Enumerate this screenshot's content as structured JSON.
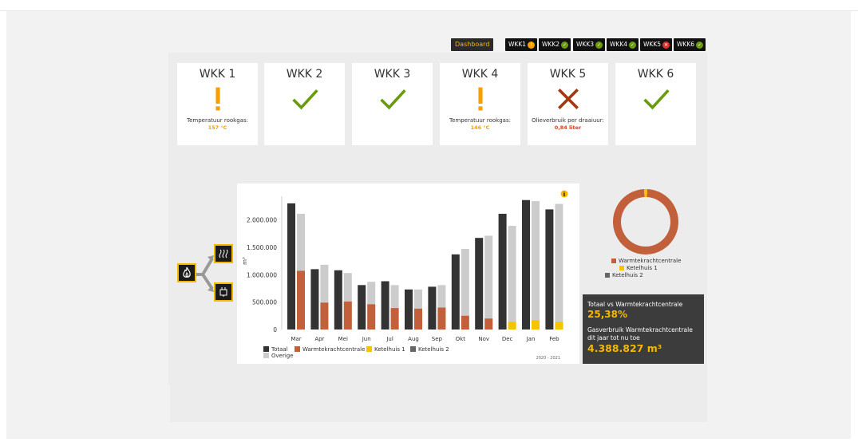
{
  "nav": {
    "dashboard_label": "Dashboard",
    "tabs": [
      {
        "label": "WKK1",
        "status": "warning"
      },
      {
        "label": "WKK2",
        "status": "ok"
      },
      {
        "label": "WKK3",
        "status": "ok"
      },
      {
        "label": "WKK4",
        "status": "ok"
      },
      {
        "label": "WKK5",
        "status": "error"
      },
      {
        "label": "WKK6",
        "status": "ok"
      }
    ]
  },
  "colors": {
    "warning": "#f5a000",
    "ok": "#6a9b0e",
    "error": "#a33812",
    "accent": "#f5b800",
    "total": "#333333",
    "other": "#cccccc",
    "warmte": "#c2603c",
    "ketel1": "#f5c400",
    "ketel2": "#666666"
  },
  "cards": [
    {
      "title": "WKK 1",
      "status": "warning",
      "icon": "exclamation-icon",
      "label": "Temperatuur rookgas:",
      "value": "157 °C"
    },
    {
      "title": "WKK 2",
      "status": "ok",
      "icon": "check-icon",
      "label": "",
      "value": ""
    },
    {
      "title": "WKK 3",
      "status": "ok",
      "icon": "check-icon",
      "label": "",
      "value": ""
    },
    {
      "title": "WKK 4",
      "status": "warning",
      "icon": "exclamation-icon",
      "label": "Temperatuur rookgas:",
      "value": "146 °C"
    },
    {
      "title": "WKK 5",
      "status": "error",
      "icon": "cross-icon",
      "label": "Olieverbruik per draaiuur:",
      "value": "0,84 liter"
    },
    {
      "title": "WKK 6",
      "status": "ok",
      "icon": "check-icon",
      "label": "",
      "value": ""
    }
  ],
  "chart_data": {
    "type": "bar",
    "categories": [
      "Mar",
      "Apr",
      "Mei",
      "Jun",
      "Jul",
      "Aug",
      "Sep",
      "Okt",
      "Nov",
      "Dec",
      "Jan",
      "Feb"
    ],
    "ylabel": "m³",
    "ylim": [
      0,
      2400000
    ],
    "yticks": [
      0,
      500000,
      1000000,
      1500000,
      2000000
    ],
    "ytick_labels": [
      "0",
      "500.000",
      "1.000.000",
      "1.500.000",
      "2.000.000"
    ],
    "series": [
      {
        "name": "Totaal",
        "values": [
          2300000,
          1100000,
          1080000,
          810000,
          880000,
          730000,
          780000,
          1370000,
          1670000,
          2110000,
          2360000,
          2190000
        ]
      },
      {
        "name": "Warmtekrachtcentrale",
        "values": [
          1070000,
          490000,
          510000,
          460000,
          390000,
          380000,
          400000,
          250000,
          200000,
          0,
          0,
          0
        ]
      },
      {
        "name": "Ketelhuis 1",
        "values": [
          0,
          0,
          0,
          0,
          0,
          0,
          0,
          0,
          0,
          140000,
          170000,
          140000
        ]
      },
      {
        "name": "Ketelhuis 2",
        "values": [
          0,
          0,
          0,
          0,
          0,
          0,
          0,
          0,
          0,
          0,
          0,
          0
        ]
      },
      {
        "name": "Overige",
        "values": [
          1040000,
          690000,
          520000,
          410000,
          420000,
          350000,
          410000,
          1220000,
          1510000,
          1750000,
          2170000,
          2150000
        ]
      }
    ],
    "legend": [
      "Totaal",
      "Warmtekrachtcentrale",
      "Ketelhuis 1",
      "Ketelhuis 2",
      "Overige"
    ],
    "legend_position": "bottom-left",
    "period_label": "2020 - 2021",
    "grid": false
  },
  "donut": {
    "legend": [
      "Warmtekrachtcentrale",
      "Ketelhuis 1",
      "Ketelhuis 2"
    ],
    "values": [
      98.5,
      1.5,
      0
    ]
  },
  "info": {
    "ratio_label": "Totaal vs Warmtekrachtcentrale",
    "ratio_value": "25,38%",
    "gas_label": "Gasverbruik Warmtekrachtcentrale dit jaar tot nu toe",
    "gas_value": "4.388.827 m³"
  }
}
